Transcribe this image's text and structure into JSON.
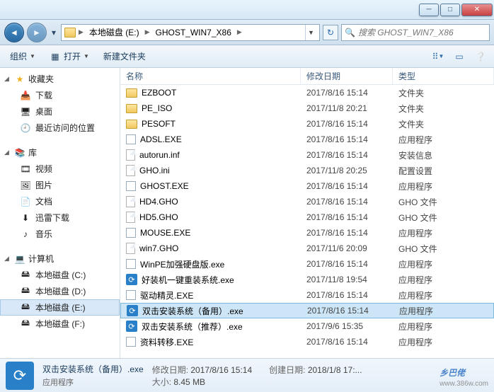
{
  "window": {
    "min": "─",
    "max": "□",
    "close": "✕"
  },
  "breadcrumb": {
    "drive": "本地磁盘 (E:)",
    "folder": "GHOST_WIN7_X86"
  },
  "search": {
    "placeholder": "搜索 GHOST_WIN7_X86"
  },
  "toolbar": {
    "organize": "组织",
    "open": "打开",
    "newfolder": "新建文件夹"
  },
  "sidebar": {
    "favorites": {
      "head": "收藏夹",
      "items": [
        "下载",
        "桌面",
        "最近访问的位置"
      ]
    },
    "libraries": {
      "head": "库",
      "items": [
        "视频",
        "图片",
        "文档",
        "迅雷下载",
        "音乐"
      ]
    },
    "computer": {
      "head": "计算机",
      "items": [
        "本地磁盘 (C:)",
        "本地磁盘 (D:)",
        "本地磁盘 (E:)",
        "本地磁盘 (F:)"
      ]
    }
  },
  "columns": {
    "name": "名称",
    "date": "修改日期",
    "type": "类型"
  },
  "files": [
    {
      "icon": "folder",
      "name": "EZBOOT",
      "date": "2017/8/16 15:14",
      "type": "文件夹"
    },
    {
      "icon": "folder",
      "name": "PE_ISO",
      "date": "2017/11/8 20:21",
      "type": "文件夹"
    },
    {
      "icon": "folder",
      "name": "PESOFT",
      "date": "2017/8/16 15:14",
      "type": "文件夹"
    },
    {
      "icon": "exe",
      "name": "ADSL.EXE",
      "date": "2017/8/16 15:14",
      "type": "应用程序"
    },
    {
      "icon": "file",
      "name": "autorun.inf",
      "date": "2017/8/16 15:14",
      "type": "安装信息"
    },
    {
      "icon": "file",
      "name": "GHO.ini",
      "date": "2017/11/8 20:25",
      "type": "配置设置"
    },
    {
      "icon": "exe",
      "name": "GHOST.EXE",
      "date": "2017/8/16 15:14",
      "type": "应用程序"
    },
    {
      "icon": "file",
      "name": "HD4.GHO",
      "date": "2017/8/16 15:14",
      "type": "GHO 文件"
    },
    {
      "icon": "file",
      "name": "HD5.GHO",
      "date": "2017/8/16 15:14",
      "type": "GHO 文件"
    },
    {
      "icon": "exe",
      "name": "MOUSE.EXE",
      "date": "2017/8/16 15:14",
      "type": "应用程序"
    },
    {
      "icon": "file",
      "name": "win7.GHO",
      "date": "2017/11/6 20:09",
      "type": "GHO 文件"
    },
    {
      "icon": "exe",
      "name": "WinPE加强硬盘版.exe",
      "date": "2017/8/16 15:14",
      "type": "应用程序"
    },
    {
      "icon": "blue",
      "name": "好装机一键重装系统.exe",
      "date": "2017/11/8 19:54",
      "type": "应用程序"
    },
    {
      "icon": "exe",
      "name": "驱动精灵.EXE",
      "date": "2017/8/16 15:14",
      "type": "应用程序"
    },
    {
      "icon": "blue",
      "name": "双击安装系统（备用）.exe",
      "date": "2017/8/16 15:14",
      "type": "应用程序",
      "selected": true
    },
    {
      "icon": "blue",
      "name": "双击安装系统（推荐）.exe",
      "date": "2017/9/6 15:35",
      "type": "应用程序"
    },
    {
      "icon": "exe",
      "name": "资料转移.EXE",
      "date": "2017/8/16 15:14",
      "type": "应用程序"
    }
  ],
  "details": {
    "filename": "双击安装系统（备用）.exe",
    "filetype": "应用程序",
    "mod_label": "修改日期:",
    "mod_val": "2017/8/16 15:14",
    "size_label": "大小:",
    "size_val": "8.45 MB",
    "create_label": "创建日期:",
    "create_val": "2018/1/8 17:..."
  },
  "watermark": {
    "main": "乡巴佬",
    "sub": "www.386w.com"
  }
}
